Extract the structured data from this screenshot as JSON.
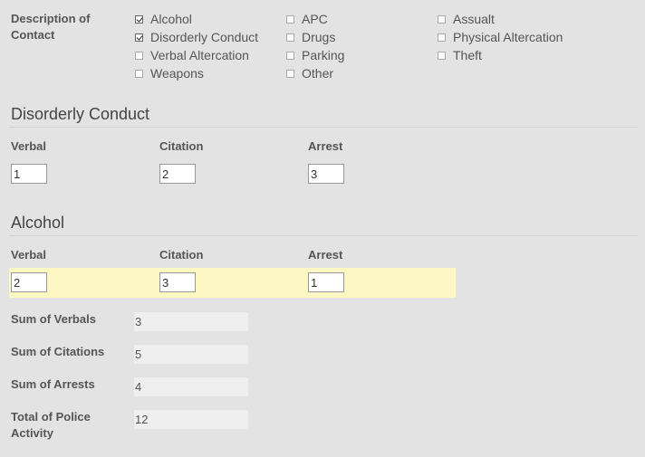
{
  "description": {
    "label": "Description of Contact",
    "columns": [
      [
        {
          "label": "Alcohol",
          "checked": true
        },
        {
          "label": "Disorderly Conduct",
          "checked": true
        },
        {
          "label": "Verbal Altercation",
          "checked": false
        },
        {
          "label": "Weapons",
          "checked": false
        }
      ],
      [
        {
          "label": "APC",
          "checked": false
        },
        {
          "label": "Drugs",
          "checked": false
        },
        {
          "label": "Parking",
          "checked": false
        },
        {
          "label": "Other",
          "checked": false
        }
      ],
      [
        {
          "label": "Assualt",
          "checked": false
        },
        {
          "label": "Physical Altercation",
          "checked": false
        },
        {
          "label": "Theft",
          "checked": false
        }
      ]
    ]
  },
  "sections": [
    {
      "title": "Disorderly Conduct",
      "verbal_label": "Verbal",
      "citation_label": "Citation",
      "arrest_label": "Arrest",
      "verbal": "1",
      "citation": "2",
      "arrest": "3"
    },
    {
      "title": "Alcohol",
      "verbal_label": "Verbal",
      "citation_label": "Citation",
      "arrest_label": "Arrest",
      "verbal": "2",
      "citation": "3",
      "arrest": "1"
    }
  ],
  "sums": {
    "verbals_label": "Sum of Verbals",
    "verbals": "3",
    "citations_label": "Sum of Citations",
    "citations": "5",
    "arrests_label": "Sum of Arrests",
    "arrests": "4",
    "total_label": "Total of Police Activity",
    "total": "12"
  },
  "colors": {
    "highlight": "#fcf7c3",
    "background": "#e3e3e3"
  }
}
